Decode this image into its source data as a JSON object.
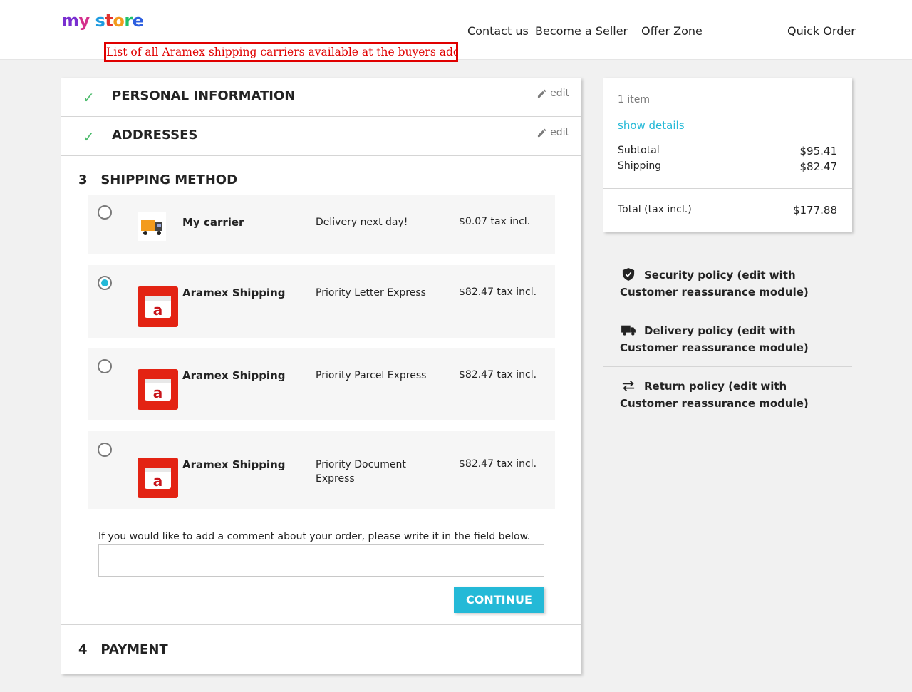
{
  "header": {
    "logo_parts": [
      "m",
      "y",
      " ",
      "s",
      "t",
      "o",
      "r",
      "e"
    ],
    "nav": {
      "contact": "Contact us",
      "seller": "Become a Seller",
      "offer": "Offer Zone",
      "quick": "Quick Order"
    }
  },
  "annotation": "List of all Aramex shipping carriers available at the buyers address",
  "checkout": {
    "personal": {
      "title": "PERSONAL INFORMATION",
      "edit": "edit"
    },
    "addresses": {
      "title": "ADDRESSES",
      "edit": "edit"
    },
    "shipping": {
      "number": "3",
      "title": "SHIPPING METHOD",
      "carriers": [
        {
          "name": "My carrier",
          "delay": "Delivery next day!",
          "price": "$0.07 tax incl.",
          "selected": false,
          "logo": "truck-logo"
        },
        {
          "name": "Aramex Shipping",
          "delay": "Priority Letter Express",
          "price": "$82.47 tax incl.",
          "selected": true,
          "logo": "aramex-logo"
        },
        {
          "name": "Aramex Shipping",
          "delay": "Priority Parcel Express",
          "price": "$82.47 tax incl.",
          "selected": false,
          "logo": "aramex-logo"
        },
        {
          "name": "Aramex Shipping",
          "delay": "Priority Document Express",
          "price": "$82.47 tax incl.",
          "selected": false,
          "logo": "aramex-logo"
        }
      ],
      "comment_label": "If you would like to add a comment about your order, please write it in the field below.",
      "comment_value": "",
      "continue": "CONTINUE"
    },
    "payment": {
      "number": "4",
      "title": "PAYMENT"
    }
  },
  "summary": {
    "items": "1 item",
    "show_details": "show details",
    "subtotal_label": "Subtotal",
    "subtotal": "$95.41",
    "shipping_label": "Shipping",
    "shipping": "$82.47",
    "total_label": "Total (tax incl.)",
    "total": "$177.88"
  },
  "reassurance": [
    {
      "icon": "shield-icon",
      "text": "Security policy (edit with Customer reassurance module)"
    },
    {
      "icon": "truck-icon",
      "text": "Delivery policy (edit with Customer reassurance module)"
    },
    {
      "icon": "swap-arrows-icon",
      "text": "Return policy (edit with Customer reassurance module)"
    }
  ],
  "colors": {
    "accent": "#24b9d7",
    "check": "#4cbb6c",
    "annotation": "#e00000",
    "aramex_red": "#e32313"
  }
}
